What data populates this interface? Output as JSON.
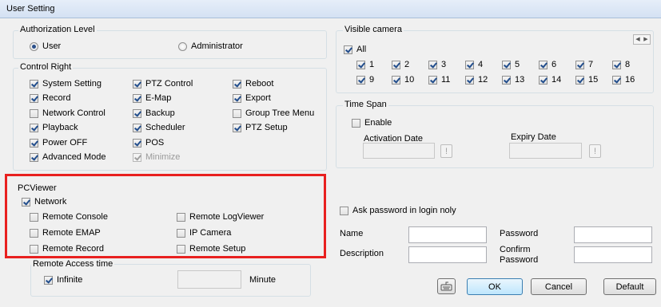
{
  "window": {
    "title": "User Setting"
  },
  "authorization": {
    "label": "Authorization Level",
    "options": [
      {
        "label": "User",
        "selected": true
      },
      {
        "label": "Administrator",
        "selected": false
      }
    ]
  },
  "control_right": {
    "label": "Control Right",
    "col1": [
      {
        "label": "System Setting",
        "checked": true
      },
      {
        "label": "Record",
        "checked": true
      },
      {
        "label": "Network Control",
        "checked": false
      },
      {
        "label": "Playback",
        "checked": true
      },
      {
        "label": "Power OFF",
        "checked": true
      },
      {
        "label": "Advanced Mode",
        "checked": true
      }
    ],
    "col2": [
      {
        "label": "PTZ Control",
        "checked": true
      },
      {
        "label": "E-Map",
        "checked": true
      },
      {
        "label": "Backup",
        "checked": true
      },
      {
        "label": "Scheduler",
        "checked": true
      },
      {
        "label": "POS",
        "checked": true
      },
      {
        "label": "Minimize",
        "checked": true,
        "disabled": true
      }
    ],
    "col3": [
      {
        "label": "Reboot",
        "checked": true
      },
      {
        "label": "Export",
        "checked": true
      },
      {
        "label": "Group Tree Menu",
        "checked": false
      },
      {
        "label": "PTZ Setup",
        "checked": true
      }
    ]
  },
  "pcviewer": {
    "label": "PCViewer",
    "network": {
      "label": "Network",
      "checked": true
    },
    "col1": [
      {
        "label": "Remote Console",
        "checked": false
      },
      {
        "label": "Remote EMAP",
        "checked": false
      },
      {
        "label": "Remote Record",
        "checked": false
      }
    ],
    "col2": [
      {
        "label": "Remote LogViewer",
        "checked": false
      },
      {
        "label": "IP Camera",
        "checked": false
      },
      {
        "label": "Remote Setup",
        "checked": false
      }
    ],
    "access_time": {
      "label": "Remote Access time",
      "infinite": {
        "label": "Infinite",
        "checked": true
      },
      "minute_value": "",
      "minute_label": "Minute"
    },
    "highlight_color": "#e8201f"
  },
  "visible_camera": {
    "label": "Visible camera",
    "all": {
      "label": "All",
      "checked": true
    },
    "cameras": [
      {
        "label": "1",
        "checked": true
      },
      {
        "label": "2",
        "checked": true
      },
      {
        "label": "3",
        "checked": true
      },
      {
        "label": "4",
        "checked": true
      },
      {
        "label": "5",
        "checked": true
      },
      {
        "label": "6",
        "checked": true
      },
      {
        "label": "7",
        "checked": true
      },
      {
        "label": "8",
        "checked": true
      },
      {
        "label": "9",
        "checked": true
      },
      {
        "label": "10",
        "checked": true
      },
      {
        "label": "11",
        "checked": true
      },
      {
        "label": "12",
        "checked": true
      },
      {
        "label": "13",
        "checked": true
      },
      {
        "label": "14",
        "checked": true
      },
      {
        "label": "15",
        "checked": true
      },
      {
        "label": "16",
        "checked": true
      }
    ],
    "pager_icons": [
      "chevron-left-icon",
      "chevron-right-icon"
    ]
  },
  "time_span": {
    "label": "Time Span",
    "enable": {
      "label": "Enable",
      "checked": false
    },
    "activation_label": "Activation Date",
    "expiry_label": "Expiry Date",
    "activation_value": "",
    "expiry_value": "",
    "picker_glyph": "!"
  },
  "login": {
    "ask_password": {
      "label": "Ask password in login noly",
      "checked": false
    },
    "name_label": "Name",
    "name_value": "",
    "password_label": "Password",
    "password_value": "",
    "description_label": "Description",
    "description_value": "",
    "confirm_label_1": "Confirm",
    "confirm_label_2": "Password",
    "confirm_value": ""
  },
  "buttons": {
    "keyboard_icon": "keyboard-icon",
    "ok": "OK",
    "cancel": "Cancel",
    "default": "Default"
  }
}
